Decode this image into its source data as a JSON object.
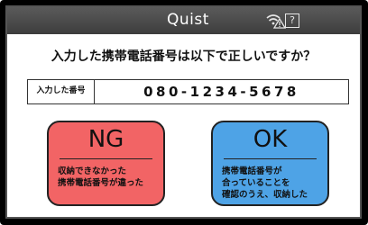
{
  "header": {
    "brand": "Quist",
    "icons": [
      "wifi-warning-icon",
      "help-icon"
    ],
    "help_glyph": "?"
  },
  "question": "入力した携帯電話番号は以下で正しいですか？",
  "number": {
    "label": "入力した番号",
    "value": "080-1234-5678"
  },
  "buttons": {
    "ng": {
      "title": "NG",
      "description": "収納できなかった\n携帯電話番号が違った",
      "color": "#f26465"
    },
    "ok": {
      "title": "OK",
      "description": "携帯電話番号が\n合っていることを\n確認のうえ、収納した",
      "color": "#4ea3e6"
    }
  }
}
